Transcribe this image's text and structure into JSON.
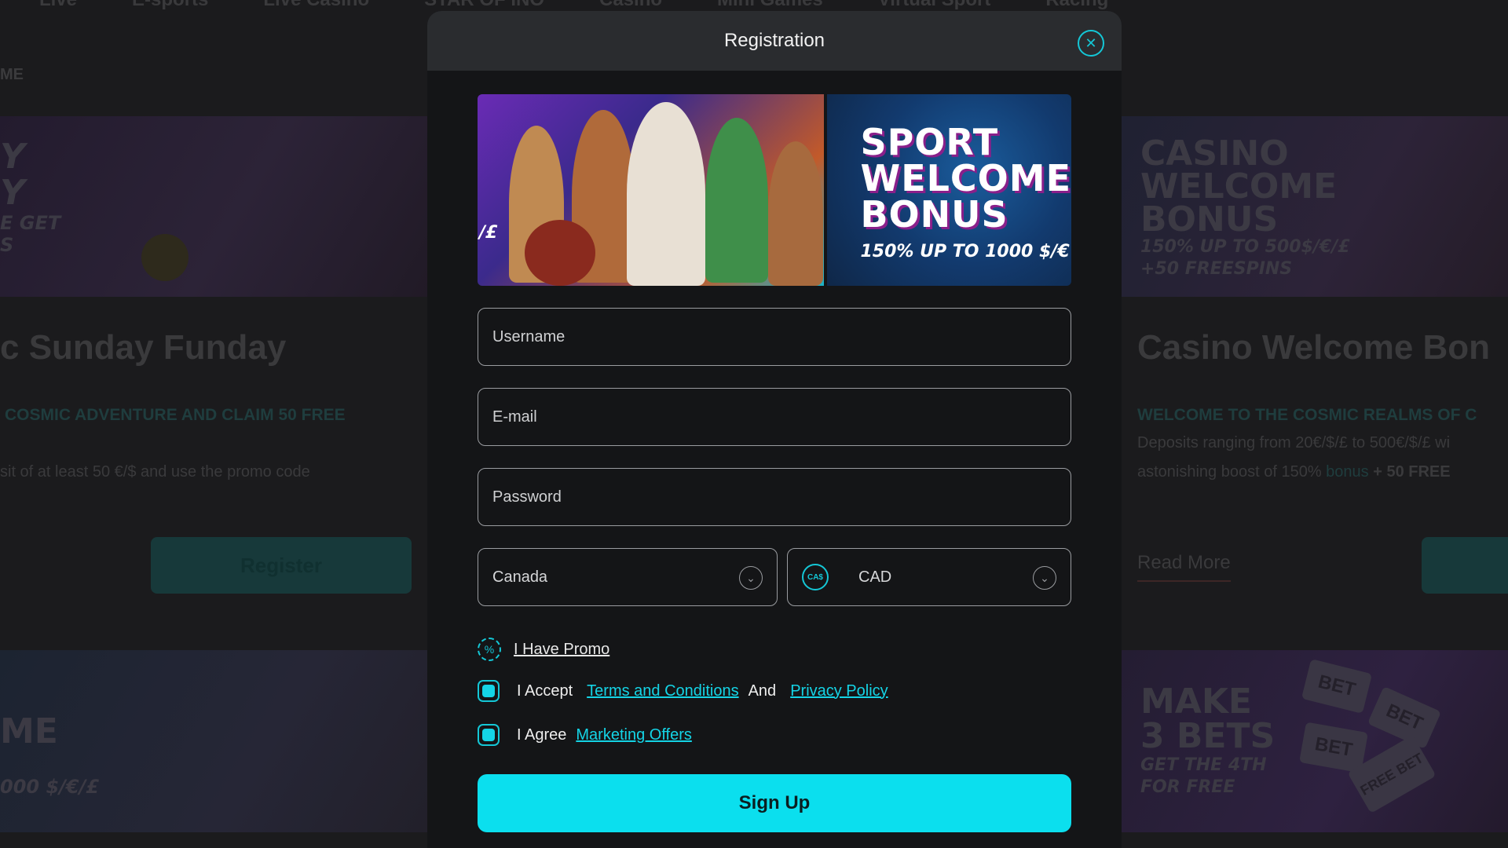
{
  "background": {
    "nav": [
      "Live",
      "E-sports",
      "Live Casino",
      "STAR OF INO",
      "Casino",
      "Mini Games",
      "Virtual Sport",
      "Racing"
    ],
    "breadcrumb": "ME",
    "left_card": {
      "promo_line1": "Y",
      "promo_line2": "Y",
      "promo_line3": "E GET",
      "promo_line4": "S",
      "title": "c Sunday Funday",
      "subtitle": "COSMIC ADVENTURE AND CLAIM 50 FREE",
      "text": "sit of at least 50 €/$ and use the promo code",
      "button": "Register"
    },
    "right_card": {
      "promo_line1": "CASINO",
      "promo_line2": "WELCOME",
      "promo_line3": "BONUS",
      "promo_line4": "150% UP TO 500$/€/£",
      "promo_line5": "+50 FREESPINS",
      "title": "Casino Welcome Bon",
      "subtitle": "WELCOME TO THE COSMIC REALMS OF C",
      "text1": "Deposits ranging from 20€/$/£ to 500€/$/£ wi",
      "text2_a": "astonishing boost of 150%",
      "text2_link": "bonus",
      "text2_b": "+ 50 FREE",
      "link": "Read More"
    },
    "left_card2": {
      "promo_line1": "ME",
      "promo_line2": "000 $/€/£"
    },
    "right_card2": {
      "promo_line1": "MAKE",
      "promo_line2": "3 BETS",
      "promo_line3": "GET THE 4TH",
      "promo_line4": "FOR FREE",
      "tag1": "BET",
      "tag2": "BET",
      "tag3": "BET",
      "tag4": "FREE BET"
    }
  },
  "modal": {
    "title": "Registration",
    "close_icon": "close-circle-icon",
    "banner": {
      "left_text": "/£",
      "line1": "SPORT",
      "line2": "WELCOME",
      "line3": "BONUS",
      "sub": "150% UP TO 1000 $/€"
    },
    "username_placeholder": "Username",
    "email_placeholder": "E-mail",
    "password_placeholder": "Password",
    "country": "Canada",
    "currency_badge": "CA$",
    "currency": "CAD",
    "promo_label": "I Have Promo",
    "accept_label": "I Accept",
    "terms_link": "Terms and Conditions",
    "and_label": "And",
    "privacy_link": "Privacy Policy",
    "agree_label": "I Agree",
    "marketing_link": "Marketing Offers",
    "signup_label": "Sign Up",
    "accent_color": "#0bdfee"
  }
}
